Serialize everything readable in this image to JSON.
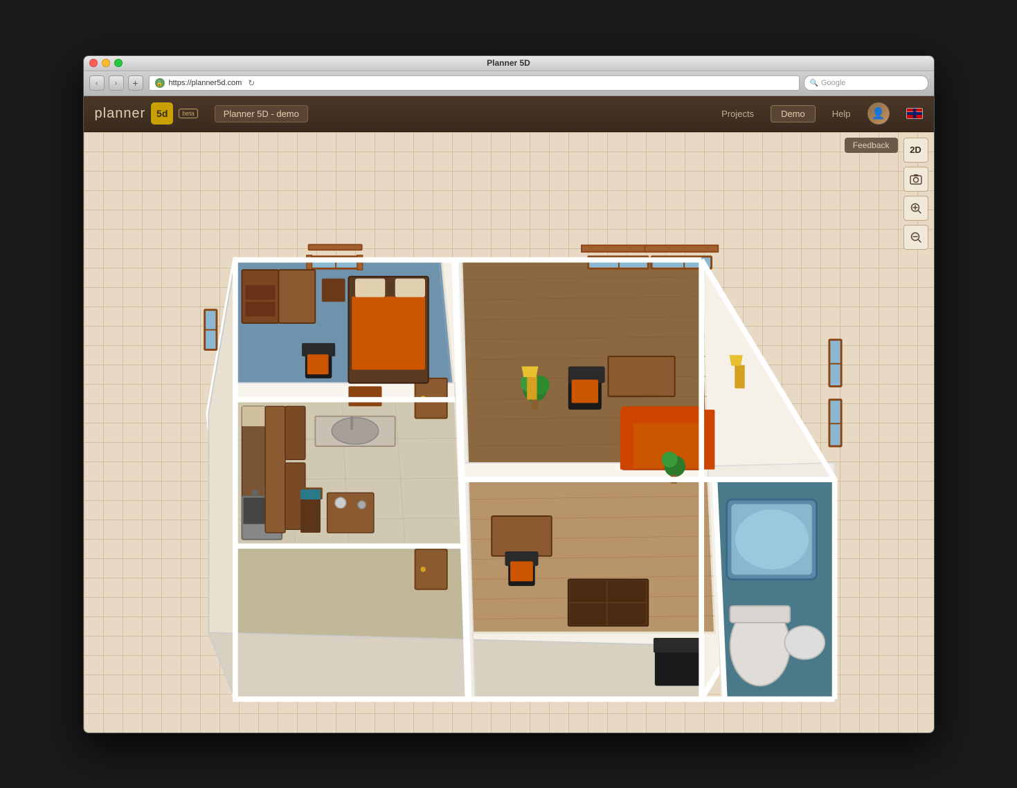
{
  "window": {
    "title": "Planner 5D",
    "os": "mac"
  },
  "browser": {
    "back_label": "‹",
    "forward_label": "›",
    "add_label": "+",
    "url": "https://planner5d.com",
    "refresh_label": "↻",
    "search_placeholder": "Google"
  },
  "app": {
    "logo_text": "planner",
    "logo_5d": "5d",
    "beta_label": "beta",
    "project_name": "Planner 5D - demo",
    "nav": {
      "projects_label": "Projects",
      "demo_label": "Demo",
      "help_label": "Help"
    },
    "feedback_label": "Feedback",
    "toolbar": {
      "view_2d_label": "2D",
      "screenshot_label": "📷",
      "zoom_in_label": "⊕",
      "zoom_out_label": "⊖"
    }
  },
  "canvas": {
    "description": "3D isometric floor plan view showing multiple rooms",
    "rooms": [
      {
        "name": "bedroom",
        "color": "#6b8fa8"
      },
      {
        "name": "kitchen",
        "color": "#d4c9b0"
      },
      {
        "name": "living_room",
        "color": "#b8a080"
      },
      {
        "name": "bathroom",
        "color": "#5a8fa8"
      }
    ]
  }
}
